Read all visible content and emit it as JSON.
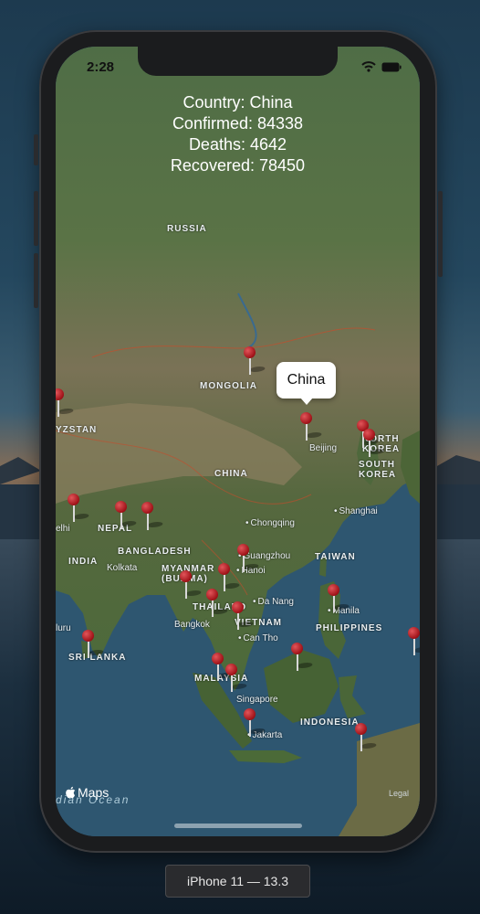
{
  "status_bar": {
    "time": "2:28"
  },
  "info": {
    "country_label": "Country:",
    "country": "China",
    "confirmed_label": "Confirmed:",
    "confirmed": "84338",
    "deaths_label": "Deaths:",
    "deaths": "4642",
    "recovered_label": "Recovered:",
    "recovered": "78450"
  },
  "callout": {
    "title": "China"
  },
  "map": {
    "labels": {
      "russia": "RUSSIA",
      "mongolia": "MONGOLIA",
      "china": "CHINA",
      "kyrgyzstan": "YZSTAN",
      "nepal": "NEPAL",
      "bangladesh": "BANGLADESH",
      "india": "INDIA",
      "myanmar": "MYANMAR\n(BURMA)",
      "thailand": "THAILAND",
      "vietnam": "VIETNAM",
      "taiwan": "TAIWAN",
      "philippines": "PHILIPPINES",
      "malaysia": "MALAYSIA",
      "indonesia": "INDONESIA",
      "sri_lanka": "SRI LANKA",
      "north_korea": "NORTH\nKOREA",
      "south_korea": "SOUTH\nKOREA",
      "beijing": "Beijing",
      "shanghai": "Shanghai",
      "chongqing": "Chongqing",
      "guangzhou": "Guangzhou",
      "hanoi": "Hanoi",
      "da_nang": "Da Nang",
      "manila": "Manila",
      "bangkok": "Bangkok",
      "can_tho": "Can Tho",
      "singapore": "Singapore",
      "jakarta": "Jakarta",
      "kolkata": "Kolkata",
      "delhi": "elhi",
      "bengaluru": "luru",
      "ocean": "dian Ocean"
    }
  },
  "footer": {
    "maps": "Maps",
    "legal": "Legal"
  },
  "device_label": "iPhone 11 — 13.3"
}
